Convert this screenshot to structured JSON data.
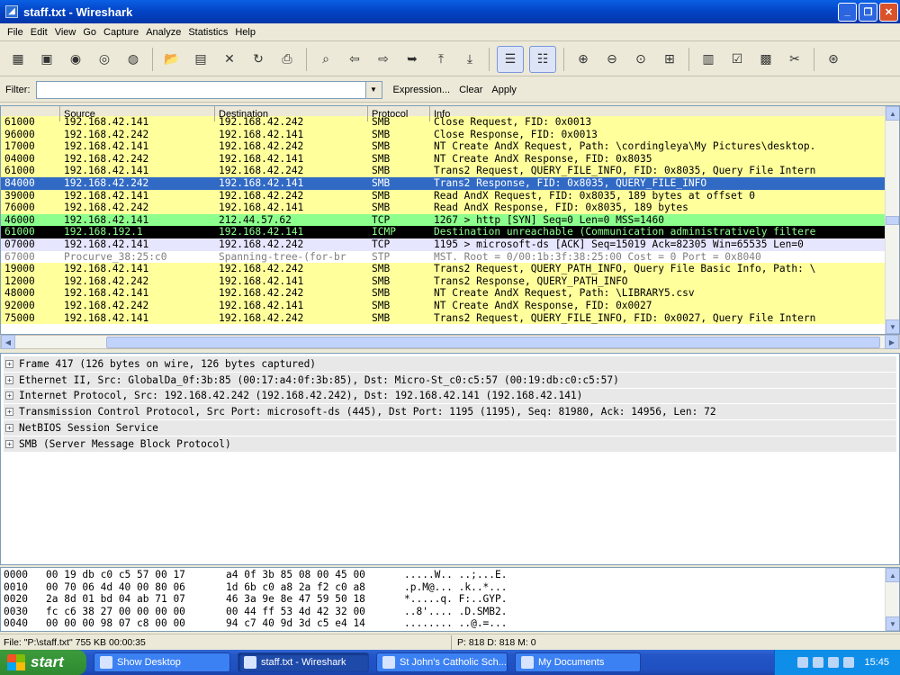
{
  "window": {
    "title": "staff.txt - Wireshark"
  },
  "menu": [
    "File",
    "Edit",
    "View",
    "Go",
    "Capture",
    "Analyze",
    "Statistics",
    "Help"
  ],
  "filter": {
    "label": "Filter:",
    "value": "",
    "expression": "Expression...",
    "clear": "Clear",
    "apply": "Apply"
  },
  "packet_list": {
    "columns": [
      "",
      "Source",
      "Destination",
      "Protocol",
      "Info"
    ],
    "rows": [
      {
        "time": "61000",
        "src": "192.168.42.141",
        "dst": "192.168.42.242",
        "proto": "SMB",
        "info": "Close Request, FID: 0x0013",
        "bg": "#ffff9c",
        "fg": "#000000"
      },
      {
        "time": "96000",
        "src": "192.168.42.242",
        "dst": "192.168.42.141",
        "proto": "SMB",
        "info": "Close Response, FID: 0x0013",
        "bg": "#ffff9c",
        "fg": "#000000"
      },
      {
        "time": "17000",
        "src": "192.168.42.141",
        "dst": "192.168.42.242",
        "proto": "SMB",
        "info": "NT Create AndX Request, Path: \\cordingleya\\My Pictures\\desktop.",
        "bg": "#ffff9c",
        "fg": "#000000"
      },
      {
        "time": "04000",
        "src": "192.168.42.242",
        "dst": "192.168.42.141",
        "proto": "SMB",
        "info": "NT Create AndX Response, FID: 0x8035",
        "bg": "#ffff9c",
        "fg": "#000000"
      },
      {
        "time": "61000",
        "src": "192.168.42.141",
        "dst": "192.168.42.242",
        "proto": "SMB",
        "info": "Trans2 Request, QUERY_FILE_INFO, FID: 0x8035, Query File Intern",
        "bg": "#ffff9c",
        "fg": "#000000"
      },
      {
        "time": "84000",
        "src": "192.168.42.242",
        "dst": "192.168.42.141",
        "proto": "SMB",
        "info": "Trans2 Response, FID: 0x8035, QUERY_FILE_INFO",
        "bg": "#316ac5",
        "fg": "#ffffff"
      },
      {
        "time": "39000",
        "src": "192.168.42.141",
        "dst": "192.168.42.242",
        "proto": "SMB",
        "info": "Read AndX Request, FID: 0x8035, 189 bytes at offset 0",
        "bg": "#ffff9c",
        "fg": "#000000"
      },
      {
        "time": "76000",
        "src": "192.168.42.242",
        "dst": "192.168.42.141",
        "proto": "SMB",
        "info": "Read AndX Response, FID: 0x8035, 189 bytes",
        "bg": "#ffff9c",
        "fg": "#000000"
      },
      {
        "time": "46000",
        "src": "192.168.42.141",
        "dst": "212.44.57.62",
        "proto": "TCP",
        "info": "1267 > http [SYN] Seq=0 Len=0 MSS=1460",
        "bg": "#8cff8c",
        "fg": "#000000"
      },
      {
        "time": "61000",
        "src": "192.168.192.1",
        "dst": "192.168.42.141",
        "proto": "ICMP",
        "info": "Destination unreachable (Communication administratively filtere",
        "bg": "#000000",
        "fg": "#8cff8c"
      },
      {
        "time": "07000",
        "src": "192.168.42.141",
        "dst": "192.168.42.242",
        "proto": "TCP",
        "info": "1195 > microsoft-ds [ACK] Seq=15019 Ack=82305 Win=65535 Len=0",
        "bg": "#e7e6ff",
        "fg": "#000000"
      },
      {
        "time": "67000",
        "src": "Procurve_38:25:c0",
        "dst": "Spanning-tree-(for-br",
        "proto": "STP",
        "info": "MST. Root = 0/00:1b:3f:38:25:00  Cost = 0  Port = 0x8040",
        "bg": "#ffffff",
        "fg": "#7f7f7f"
      },
      {
        "time": "19000",
        "src": "192.168.42.141",
        "dst": "192.168.42.242",
        "proto": "SMB",
        "info": "Trans2 Request, QUERY_PATH_INFO, Query File Basic Info, Path: \\",
        "bg": "#ffff9c",
        "fg": "#000000"
      },
      {
        "time": "12000",
        "src": "192.168.42.242",
        "dst": "192.168.42.141",
        "proto": "SMB",
        "info": "Trans2 Response, QUERY_PATH_INFO",
        "bg": "#ffff9c",
        "fg": "#000000"
      },
      {
        "time": "48000",
        "src": "192.168.42.141",
        "dst": "192.168.42.242",
        "proto": "SMB",
        "info": "NT Create AndX Request, Path: \\LIBRARY5.csv",
        "bg": "#ffff9c",
        "fg": "#000000"
      },
      {
        "time": "92000",
        "src": "192.168.42.242",
        "dst": "192.168.42.141",
        "proto": "SMB",
        "info": "NT Create AndX Response, FID: 0x0027",
        "bg": "#ffff9c",
        "fg": "#000000"
      },
      {
        "time": "75000",
        "src": "192.168.42.141",
        "dst": "192.168.42.242",
        "proto": "SMB",
        "info": "Trans2 Request, QUERY_FILE_INFO, FID: 0x0027, Query File Intern",
        "bg": "#ffff9c",
        "fg": "#000000"
      }
    ]
  },
  "details": [
    "Frame 417 (126 bytes on wire, 126 bytes captured)",
    "Ethernet II, Src: GlobalDa_0f:3b:85 (00:17:a4:0f:3b:85), Dst: Micro-St_c0:c5:57 (00:19:db:c0:c5:57)",
    "Internet Protocol, Src: 192.168.42.242 (192.168.42.242), Dst: 192.168.42.141 (192.168.42.141)",
    "Transmission Control Protocol, Src Port: microsoft-ds (445), Dst Port: 1195 (1195), Seq: 81980, Ack: 14956, Len: 72",
    "NetBIOS Session Service",
    "SMB (Server Message Block Protocol)"
  ],
  "hex": [
    {
      "off": "0000",
      "h1": "00 19 db c0 c5 57 00 17",
      "h2": "a4 0f 3b 85 08 00 45 00",
      "asc": ".....W.. ..;...E."
    },
    {
      "off": "0010",
      "h1": "00 70 06 4d 40 00 80 06",
      "h2": "1d 6b c0 a8 2a f2 c0 a8",
      "asc": ".p.M@... .k..*..."
    },
    {
      "off": "0020",
      "h1": "2a 8d 01 bd 04 ab 71 07",
      "h2": "46 3a 9e 8e 47 59 50 18",
      "asc": "*.....q. F:..GYP."
    },
    {
      "off": "0030",
      "h1": "fc c6 38 27 00 00 00 00",
      "h2": "00 44 ff 53 4d 42 32 00",
      "asc": "..8'.... .D.SMB2."
    },
    {
      "off": "0040",
      "h1": "00 00 00 98 07 c8 00 00",
      "h2": "94 c7 40 9d 3d c5 e4 14",
      "asc": "........ ..@.=..."
    }
  ],
  "status": {
    "file": "File: \"P:\\staff.txt\" 755 KB 00:00:35",
    "packets": "P: 818 D: 818 M: 0"
  },
  "taskbar": {
    "start": "start",
    "tasks": [
      "Show Desktop",
      "staff.txt - Wireshark",
      "St John's Catholic Sch...",
      "My Documents"
    ],
    "clock": "15:45"
  }
}
